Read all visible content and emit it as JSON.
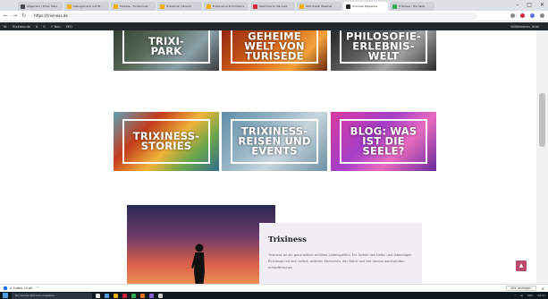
{
  "browser": {
    "tabs": [
      {
        "label": "Allgemein | Einst. Marc",
        "color": "#4a4a4a",
        "active": false
      },
      {
        "label": "Management und Bl.",
        "color": "#f0b000",
        "active": false
      },
      {
        "label": "Modelle - Funkschutz",
        "color": "#f0b000",
        "active": false
      },
      {
        "label": "Trixiefrost | Muschi",
        "color": "#f0b000",
        "active": false
      },
      {
        "label": "Experience Ecommerce",
        "color": "#f0b000",
        "active": false
      },
      {
        "label": "Welcome to the Auct.",
        "color": "#d0253a",
        "active": false
      },
      {
        "label": "SCO Public Webinar",
        "color": "#f0b000",
        "active": false
      },
      {
        "label": "Trixiness Magazine",
        "color": "#222222",
        "active": true
      },
      {
        "label": "Trixiness - Die Seite",
        "color": "#34a853",
        "active": false
      }
    ],
    "url": "https://trixiness.de",
    "window_controls": [
      "–",
      "□",
      "✕"
    ],
    "extension_colors": [
      "#888888",
      "#d0253a",
      "#5b6ee1",
      "#888888"
    ]
  },
  "wpbar": {
    "items": [
      "W",
      "Trixiness.de",
      "8",
      "0",
      "+ Neu",
      "SEO"
    ],
    "right_label": "Willkommen, Ariel"
  },
  "tiles": [
    {
      "id": "t1",
      "label_lines": [
        "TRIXI-",
        "PARK"
      ]
    },
    {
      "id": "t2",
      "label_lines": [
        "GEHEIME",
        "WELT VON",
        "TURISEDE"
      ]
    },
    {
      "id": "t3",
      "label_lines": [
        "PHILOSOFIE-",
        "ERLEBNIS-",
        "WELT"
      ]
    },
    {
      "id": "t4",
      "label_lines": [
        "TRIXINESS-",
        "STORIES"
      ]
    },
    {
      "id": "t5",
      "label_lines": [
        "TRIXINESS-",
        "REISEN UND",
        "EVENTS"
      ]
    },
    {
      "id": "t6",
      "label_lines": [
        "BLOG: WAS",
        "IST DIE",
        "SEELE?"
      ]
    }
  ],
  "feature_card": {
    "title": "Trixiness",
    "text": "Trixiness ist ein ganzheitlich erfülltes Lebensgefühl. Ein Gefühl des tiefen und lebendigen Einklangs mit sich selbst, anderen Menschen, der Natur und der daraus wachsenden schöpferischen"
  },
  "back_to_top_icon": "chevron-up",
  "download_bar": {
    "file": "A Suites 10.gif",
    "expand": "^",
    "show_all": "Alle anzeigen",
    "close": "✕"
  },
  "taskbar": {
    "search_placeholder": "Zur Suche Text hier eingeben",
    "app_colors": [
      "#e6e6e6",
      "#4aa0e6",
      "#f0b000",
      "#d0253a",
      "#34a853",
      "#e6711f",
      "#8a5cd6",
      "#cccccc"
    ],
    "tray": [
      "^",
      "◂)",
      "DEU",
      "09:41"
    ]
  }
}
